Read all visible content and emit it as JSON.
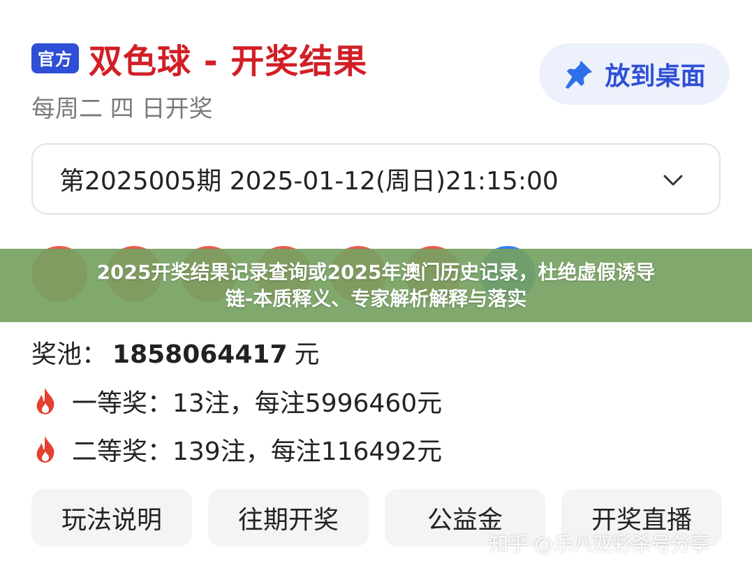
{
  "header": {
    "badge": "官方",
    "title": "双色球 - 开奖结果",
    "subtitle": "每周二 四 日开奖",
    "pin_button_label": "放到桌面",
    "pin_icon": "pin-icon"
  },
  "issue": {
    "selected": "第2025005期 2025-01-12(周日)21:15:00",
    "chevron_icon": "chevron-down-icon"
  },
  "balls": {
    "colors": [
      "#e85b4b",
      "#e85b4b",
      "#e85b4b",
      "#e85b4b",
      "#e85b4b",
      "#e85b4b",
      "#2f7df0"
    ]
  },
  "overlay": {
    "line1": "2025开奖结果记录查询或2025年澳门历史记录，杜绝虚假诱导",
    "line2": "链-本质释义、专家解析解释与落实"
  },
  "jackpot": {
    "label": "奖池：",
    "value": "1858064417",
    "unit": "元"
  },
  "prizes": [
    {
      "text": "一等奖：13注，每注5996460元",
      "icon": "flame-icon"
    },
    {
      "text": "二等奖：139注，每注116492元",
      "icon": "flame-icon"
    }
  ],
  "buttons": [
    {
      "label": "玩法说明"
    },
    {
      "label": "往期开奖"
    },
    {
      "label": "公益金"
    },
    {
      "label": "开奖直播"
    }
  ],
  "watermark": "知乎 @乐八双彩杀号分享",
  "colors": {
    "title_red": "#d21f26",
    "badge_blue": "#2f4fd6",
    "overlay_green": "#76a262"
  }
}
